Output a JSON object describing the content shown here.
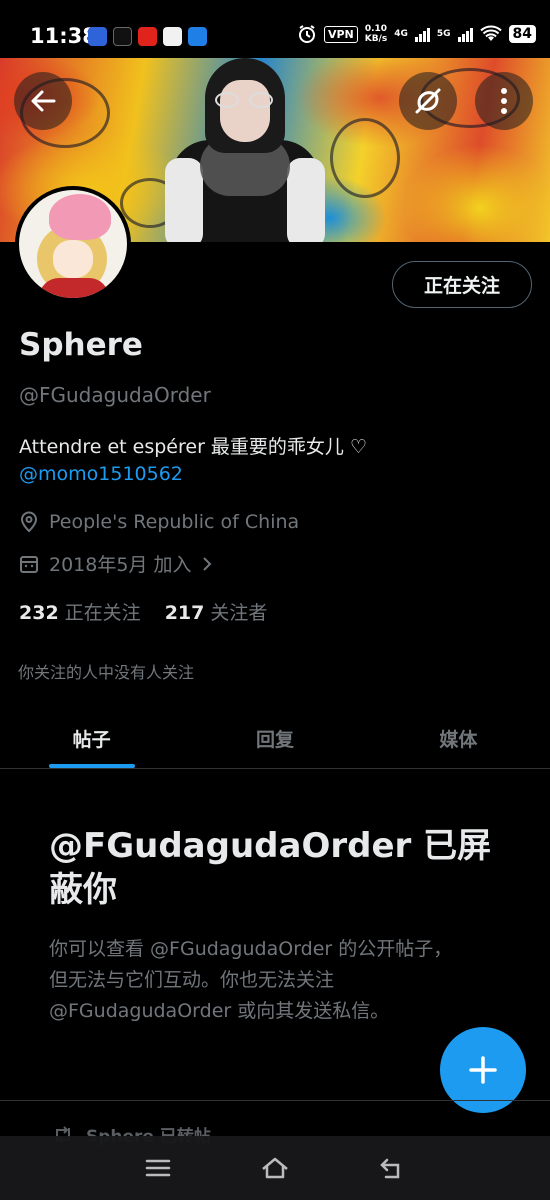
{
  "status_bar": {
    "time": "11:38",
    "vpn": "VPN",
    "speed_value": "0.10",
    "speed_unit": "KB/s",
    "net1": "4G",
    "net2": "5G",
    "battery": "84"
  },
  "profile": {
    "name": "Sphere",
    "handle": "@FGudagudaOrder",
    "bio": "Attendre et espérer 最重要的乖女儿 ♡",
    "mention": "@momo1510562",
    "location": "People's Republic of China",
    "joined": "2018年5月 加入",
    "following_count": "232",
    "following_label": "正在关注",
    "followers_count": "217",
    "followers_label": "关注者",
    "followed_by_note": "你关注的人中没有人关注",
    "follow_button": "正在关注"
  },
  "tabs": [
    {
      "label": "帖子",
      "active": true
    },
    {
      "label": "回复",
      "active": false
    },
    {
      "label": "媒体",
      "active": false
    }
  ],
  "blocked": {
    "title": "@FGudagudaOrder 已屏蔽你",
    "body": "你可以查看 @FGudagudaOrder 的公开帖子，但无法与它们互动。你也无法关注 @FGudagudaOrder 或向其发送私信。"
  },
  "retweet_label": "Sphere 已转帖",
  "colors": {
    "accent": "#1d9bf0",
    "background": "#000000",
    "text_primary": "#e7e9ea",
    "text_secondary": "#71767b"
  },
  "icons": {
    "back": "arrow-left-icon",
    "sync": "sync-icon",
    "more": "more-vertical-icon",
    "location": "location-pin-icon",
    "calendar": "calendar-icon",
    "compose": "plus-icon",
    "retweet": "retweet-icon"
  }
}
